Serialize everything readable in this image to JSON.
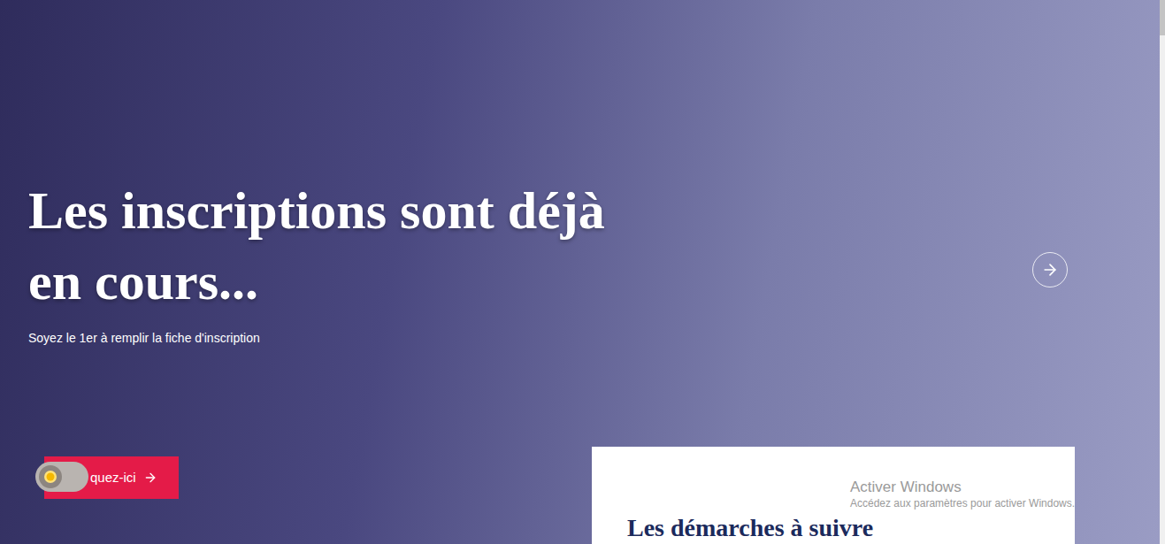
{
  "slide": {
    "title": "Les inscriptions sont déjà en cours...",
    "subtitle": "Soyez le 1er à remplir la fiche d'inscription",
    "button": "quez-ici"
  },
  "theme_toggle": {
    "dark_mode": false
  },
  "card": {
    "title": "Les démarches à suivre"
  },
  "watermark": {
    "title": "Activer Windows",
    "text": "Accédez aux paramètres pour activer Windows."
  }
}
